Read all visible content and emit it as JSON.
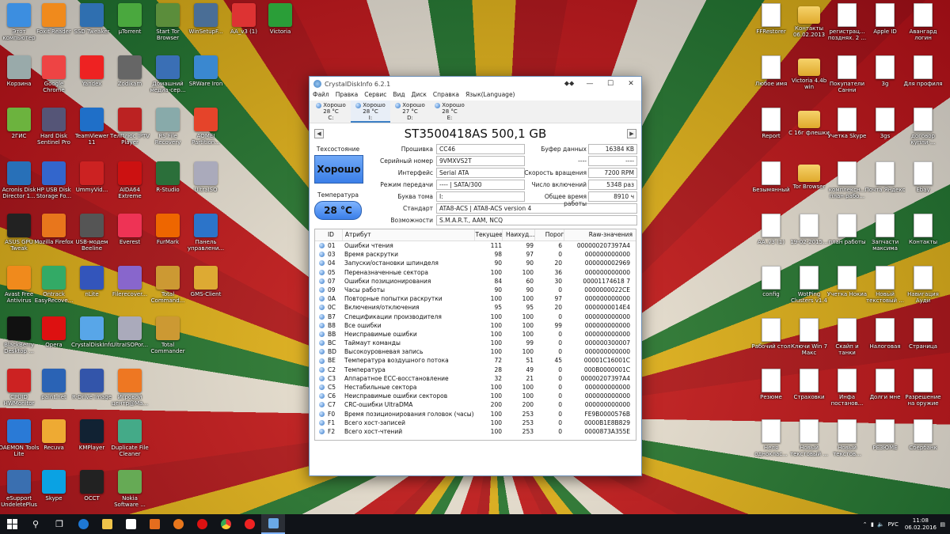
{
  "desktop_icons": [
    {
      "label": "Этот компьютер",
      "color": "#3c8ee0"
    },
    {
      "label": "Foxit Reader",
      "color": "#f08a1c"
    },
    {
      "label": "SSD Tweaker",
      "color": "#2f6fb0"
    },
    {
      "label": "µTorrent",
      "color": "#4aa83e"
    },
    {
      "label": "Start Tor Browser",
      "color": "#5b8d3b"
    },
    {
      "label": "WinSetupF...",
      "color": "#4a6e96"
    },
    {
      "label": "AA_v3 (1)",
      "color": "#d33"
    },
    {
      "label": "Victoria",
      "color": "#2a9e38"
    },
    {
      "label": "Корзина",
      "color": "#9aa"
    },
    {
      "label": "Google Chrome",
      "color": "#e44"
    },
    {
      "label": "Yandex",
      "color": "#e22"
    },
    {
      "label": "Zodikam",
      "color": "#666"
    },
    {
      "label": "Домашний медиа-сер...",
      "color": "#3a6fb5"
    },
    {
      "label": "SRWare Iron",
      "color": "#3a88d0"
    },
    {
      "label": "2ГИС",
      "color": "#6cb33e"
    },
    {
      "label": "Hard Disk Sentinel Pro",
      "color": "#557"
    },
    {
      "label": "TeamViewer 11",
      "color": "#1f6fc8"
    },
    {
      "label": "ТелПлюс IPTV Player",
      "color": "#b22"
    },
    {
      "label": "RS File Recovery",
      "color": "#8aa"
    },
    {
      "label": "AOMEI Partition...",
      "color": "#e5442a"
    },
    {
      "label": "Acronis Disk Director 1...",
      "color": "#2870b8"
    },
    {
      "label": "HP USB Disk Storage Fo...",
      "color": "#36c"
    },
    {
      "label": "UmmyVid...",
      "color": "#c22"
    },
    {
      "label": "AIDA64 Extreme",
      "color": "#c11"
    },
    {
      "label": "R-Studio",
      "color": "#2b6f3a"
    },
    {
      "label": "UltraISO",
      "color": "#aab"
    },
    {
      "label": "ASUS GPU Tweak",
      "color": "#222"
    },
    {
      "label": "Mozilla Firefox",
      "color": "#e8761c"
    },
    {
      "label": "USB-модем Beeline",
      "color": "#555"
    },
    {
      "label": "Everest",
      "color": "#e35"
    },
    {
      "label": "FurMark",
      "color": "#e60"
    },
    {
      "label": "Панель управлени...",
      "color": "#2c74c9"
    },
    {
      "label": "Avast Free Antivirus",
      "color": "#f08a1c"
    },
    {
      "label": "Ontrack EasyRecove...",
      "color": "#3a6"
    },
    {
      "label": "nLite",
      "color": "#35b"
    },
    {
      "label": "Filerecover...",
      "color": "#86c"
    },
    {
      "label": "Total Command...",
      "color": "#c93"
    },
    {
      "label": "GMS-Client",
      "color": "#da3"
    },
    {
      "label": "BlackBerry Desktop ...",
      "color": "#111"
    },
    {
      "label": "Opera",
      "color": "#d11"
    },
    {
      "label": "CrystalDiskInfo",
      "color": "#58a6e8"
    },
    {
      "label": "UltraISOPor...",
      "color": "#aab"
    },
    {
      "label": "Total Commander",
      "color": "#c93"
    },
    {
      "label": "CPUID HWMonitor",
      "color": "#c22"
    },
    {
      "label": "paint.net",
      "color": "#2a63b5"
    },
    {
      "label": "R-Drive Image",
      "color": "#35a"
    },
    {
      "label": "Игровой центр@Ma...",
      "color": "#e72"
    },
    {
      "label": "DAEMON Tools Lite",
      "color": "#2a7ad6"
    },
    {
      "label": "Recuva",
      "color": "#ea3"
    },
    {
      "label": "KMPlayer",
      "color": "#123"
    },
    {
      "label": "Duplicate File Cleaner",
      "color": "#4a8"
    },
    {
      "label": "eSupport UndeletePlus",
      "color": "#3a6fb0"
    },
    {
      "label": "Skype",
      "color": "#0aa2e3"
    },
    {
      "label": "OCCT",
      "color": "#222"
    },
    {
      "label": "Nokia Software ...",
      "color": "#6a5"
    }
  ],
  "right_icons": [
    {
      "label": "FFRestorer",
      "type": "doc"
    },
    {
      "label": "Контакты 06.02.2013",
      "type": "folder"
    },
    {
      "label": "регистрац... позднях. 2 ...",
      "type": "doc"
    },
    {
      "label": "Apple ID",
      "type": "doc"
    },
    {
      "label": "Авангард логин",
      "type": "doc"
    },
    {
      "label": "Любое имя",
      "type": "doc"
    },
    {
      "label": "Victoria 4.4b win",
      "type": "folder"
    },
    {
      "label": "Покупатели Санни",
      "type": "doc"
    },
    {
      "label": "3g",
      "type": "doc"
    },
    {
      "label": "Для профиля",
      "type": "doc"
    },
    {
      "label": "Report",
      "type": "doc"
    },
    {
      "label": "С 16г флешки",
      "type": "folder"
    },
    {
      "label": "Учетка Skype",
      "type": "doc"
    },
    {
      "label": "3gs",
      "type": "doc"
    },
    {
      "label": "договор купли-...",
      "type": "doc"
    },
    {
      "label": "Безымянный",
      "type": "doc"
    },
    {
      "label": "Tor Browser",
      "type": "folder"
    },
    {
      "label": "комплексн... план рабо...",
      "type": "doc"
    },
    {
      "label": "Почта Яндекс",
      "type": "doc"
    },
    {
      "label": "Ebay",
      "type": "doc"
    },
    {
      "label": "AA_v3 (1)",
      "type": "doc"
    },
    {
      "label": "19-02-2015...",
      "type": "doc"
    },
    {
      "label": "план работы",
      "type": "doc"
    },
    {
      "label": "Запчасти максима",
      "type": "doc"
    },
    {
      "label": "Контакты",
      "type": "doc"
    },
    {
      "label": "config",
      "type": "doc"
    },
    {
      "label": "WotPing Clusters v1.4",
      "type": "doc"
    },
    {
      "label": "Учетка Нокиа",
      "type": "doc"
    },
    {
      "label": "Новый текстовый ...",
      "type": "doc"
    },
    {
      "label": "Навигация Ауди",
      "type": "doc"
    },
    {
      "label": "Рабочий стол",
      "type": "doc"
    },
    {
      "label": "Ключи Win 7 Макс",
      "type": "doc"
    },
    {
      "label": "Скайп и танки",
      "type": "doc"
    },
    {
      "label": "Налоговая",
      "type": "doc"
    },
    {
      "label": "Страница",
      "type": "doc"
    },
    {
      "label": "Резюме",
      "type": "doc"
    },
    {
      "label": "Страховки",
      "type": "doc"
    },
    {
      "label": "Инфа постанов...",
      "type": "doc"
    },
    {
      "label": "Долги мне",
      "type": "doc"
    },
    {
      "label": "Разрешение на оружие",
      "type": "doc"
    },
    {
      "label": "Неля одноклас...",
      "type": "doc"
    },
    {
      "label": "Новый текстовый ...",
      "type": "doc"
    },
    {
      "label": "Новый текстов...",
      "type": "doc"
    },
    {
      "label": "РЕЗЮМЕ",
      "type": "doc"
    },
    {
      "label": "Сбербанк",
      "type": "doc"
    }
  ],
  "window": {
    "title": "CrystalDiskInfo 6.2.1",
    "controls": {
      "extra": "⬥⬥",
      "min": "—",
      "max": "☐",
      "close": "✕"
    },
    "menu": [
      "Файл",
      "Правка",
      "Сервис",
      "Вид",
      "Диск",
      "Справка",
      "Язык(Language)"
    ],
    "drives": [
      {
        "status": "Хорошо",
        "temp": "28 °C",
        "letter": "C:"
      },
      {
        "status": "Хорошо",
        "temp": "28 °C",
        "letter": "I:"
      },
      {
        "status": "Хорошо",
        "temp": "27 °C",
        "letter": "D:"
      },
      {
        "status": "Хорошо",
        "temp": "28 °C",
        "letter": "E:"
      }
    ],
    "model": "ST3500418AS 500,1 GB",
    "prev": "◀",
    "next": "▶",
    "health_label": "Техсостояние",
    "health_value": "Хорошо",
    "temp_label": "Температура",
    "temp_value": "28 °C",
    "fields": {
      "firmware_label": "Прошивка",
      "firmware": "CC46",
      "serial_label": "Серийный номер",
      "serial": "9VMXVS2T",
      "interface_label": "Интерфейс",
      "interface": "Serial ATA",
      "transfer_label": "Режим передачи",
      "transfer": "---- | SATA/300",
      "letter_label": "Буква тома",
      "letter": "I:",
      "standard_label": "Стандарт",
      "standard": "ATA8-ACS | ATA8-ACS version 4",
      "features_label": "Возможности",
      "features": "S.M.A.R.T., AAM, NCQ",
      "buffer_label": "Буфер данных",
      "buffer": "16384 KB",
      "na1_label": "----",
      "na1": "----",
      "rpm_label": "Скорость вращения",
      "rpm": "7200 RPM",
      "power_count_label": "Число включений",
      "power_count": "5348 раз",
      "power_hours_label": "Общее время работы",
      "power_hours": "8910 ч"
    },
    "table": {
      "headers": {
        "id": "ID",
        "attr": "Атрибут",
        "cur": "Текущее",
        "worst": "Наихуд...",
        "thr": "Порог",
        "raw": "Raw-значения"
      },
      "rows": [
        [
          "01",
          "Ошибки чтения",
          "111",
          "99",
          "6",
          "000000207397A4"
        ],
        [
          "03",
          "Время раскрутки",
          "98",
          "97",
          "0",
          "000000000000"
        ],
        [
          "04",
          "Запуски/остановки шпинделя",
          "90",
          "90",
          "20",
          "000000002969"
        ],
        [
          "05",
          "Переназначенные сектора",
          "100",
          "100",
          "36",
          "000000000000"
        ],
        [
          "07",
          "Ошибки позиционирования",
          "84",
          "60",
          "30",
          "00001174618 7"
        ],
        [
          "09",
          "Часы работы",
          "90",
          "90",
          "0",
          "0000000022CE"
        ],
        [
          "0A",
          "Повторные попытки раскрутки",
          "100",
          "100",
          "97",
          "000000000000"
        ],
        [
          "0C",
          "Включения/отключения",
          "95",
          "95",
          "20",
          "0000000014E4"
        ],
        [
          "B7",
          "Спецификации производителя",
          "100",
          "100",
          "0",
          "000000000000"
        ],
        [
          "B8",
          "Все ошибки",
          "100",
          "100",
          "99",
          "000000000000"
        ],
        [
          "BB",
          "Неисправимые ошибки",
          "100",
          "100",
          "0",
          "000000000000"
        ],
        [
          "BC",
          "Таймаут команды",
          "100",
          "99",
          "0",
          "000000300007"
        ],
        [
          "BD",
          "Высокоуровневая запись",
          "100",
          "100",
          "0",
          "000000000000"
        ],
        [
          "BE",
          "Температура воздушного потока",
          "72",
          "51",
          "45",
          "00001C16001C"
        ],
        [
          "C2",
          "Температура",
          "28",
          "49",
          "0",
          "000B0000001C"
        ],
        [
          "C3",
          "Аппаратное ECC-восстановление",
          "32",
          "21",
          "0",
          "00000207397A4"
        ],
        [
          "C5",
          "Нестабильные сектора",
          "100",
          "100",
          "0",
          "000000000000"
        ],
        [
          "C6",
          "Неисправимые ошибки секторов",
          "100",
          "100",
          "0",
          "000000000000"
        ],
        [
          "C7",
          "CRC-ошибки UltraDMA",
          "200",
          "200",
          "0",
          "000000000000"
        ],
        [
          "F0",
          "Время позиционирования головок (часы)",
          "100",
          "253",
          "0",
          "FE9B0000576B"
        ],
        [
          "F1",
          "Всего хост-записей",
          "100",
          "253",
          "0",
          "0000B1E8B829"
        ],
        [
          "F2",
          "Всего хост-чтений",
          "100",
          "253",
          "0",
          "0000873A355E"
        ]
      ]
    }
  },
  "taskbar": {
    "lang": "РУС",
    "time": "11:08",
    "date": "06.02.2016"
  }
}
